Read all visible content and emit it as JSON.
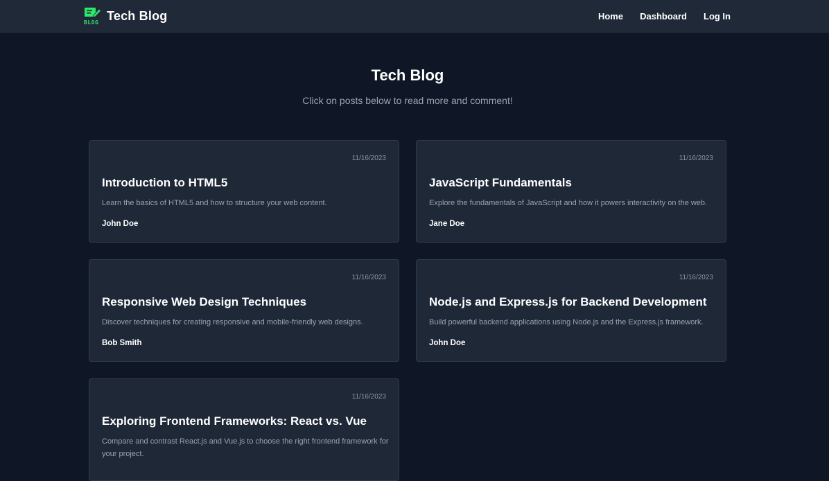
{
  "nav": {
    "brand_logo_text": "BLOG",
    "brand_name": "Tech Blog",
    "links": [
      "Home",
      "Dashboard",
      "Log In"
    ]
  },
  "hero": {
    "title": "Tech Blog",
    "subtitle": "Click on posts below to read more and comment!"
  },
  "posts": [
    {
      "date": "11/16/2023",
      "title": "Introduction to HTML5",
      "description": "Learn the basics of HTML5 and how to structure your web content.",
      "author": "John Doe"
    },
    {
      "date": "11/16/2023",
      "title": "JavaScript Fundamentals",
      "description": "Explore the fundamentals of JavaScript and how it powers interactivity on the web.",
      "author": "Jane Doe"
    },
    {
      "date": "11/16/2023",
      "title": "Responsive Web Design Techniques",
      "description": "Discover techniques for creating responsive and mobile-friendly web designs.",
      "author": "Bob Smith"
    },
    {
      "date": "11/16/2023",
      "title": "Node.js and Express.js for Backend Development",
      "description": "Build powerful backend applications using Node.js and the Express.js framework.",
      "author": "John Doe"
    },
    {
      "date": "11/16/2023",
      "title": "Exploring Frontend Frameworks: React vs. Vue",
      "description": "Compare and contrast React.js and Vue.js to choose the right frontend framework for your project.",
      "author": ""
    }
  ],
  "colors": {
    "page_bg": "#0f1726",
    "nav_bg": "#1f2937",
    "card_bg": "#1e2837",
    "logo_accent": "#2ee86a"
  }
}
